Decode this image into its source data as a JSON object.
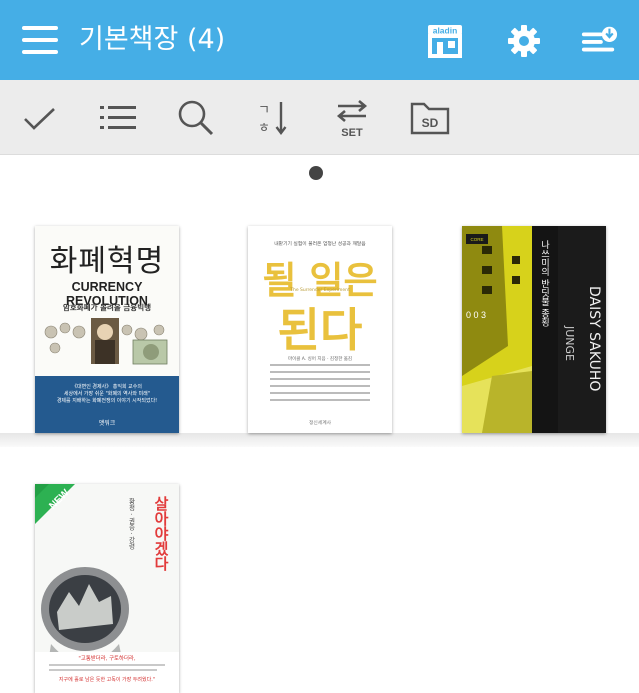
{
  "header": {
    "title": "기본책장 (4)",
    "accent_color": "#45aee6",
    "icons": [
      "menu-icon",
      "aladin-store-icon",
      "gear-icon",
      "download-list-icon"
    ],
    "store_label": "aladin"
  },
  "toolbar": {
    "icons": [
      "check-icon",
      "list-icon",
      "search-icon",
      "sort-icon",
      "set-switch-icon",
      "sd-card-icon"
    ],
    "set_label": "SET",
    "sd_label": "SD",
    "sort_label": "ㄱ\nㅎ"
  },
  "books": [
    {
      "title": "화폐혁명",
      "subtitle": "CURRENCY REVOLUTION",
      "tagline": "암호화폐가 몰려올 금융빅뱅",
      "quote": "《대변인 경제사》 홍익희 교수의\n세상에서 가장 쉬운 \"화폐의 역사와 미래\"\n경제를 지배하는 화폐전쟁의 이야기 시작되었다!",
      "publisher": "앳워크"
    },
    {
      "title_line1": "될 일은",
      "title_line2": "된다",
      "subtitle": "내맡기기 실험이 불러온 엄청난 성공과 깨달음",
      "english": "The Surrender Experiment",
      "author": "마이클 A. 싱어 지음 · 김정한 옮김",
      "publisher": "정신세계사"
    },
    {
      "title_vertical": "나쓰미의 반딧불 종횡",
      "series": "0 0 3",
      "publisher_badge": "CORE",
      "romaji": "DAISY SAKUHO",
      "romaji2": "JUNGE"
    },
    {
      "badge": "NEW",
      "title_vertical": "살아야겠다",
      "author_vertical": "황정 · 권종 · 강령",
      "quote1": "\"고통받더라, 구토하더라,",
      "quote2": "지구에 홀로 남은 듯한 고독이 가장 두려웠다.\""
    }
  ]
}
